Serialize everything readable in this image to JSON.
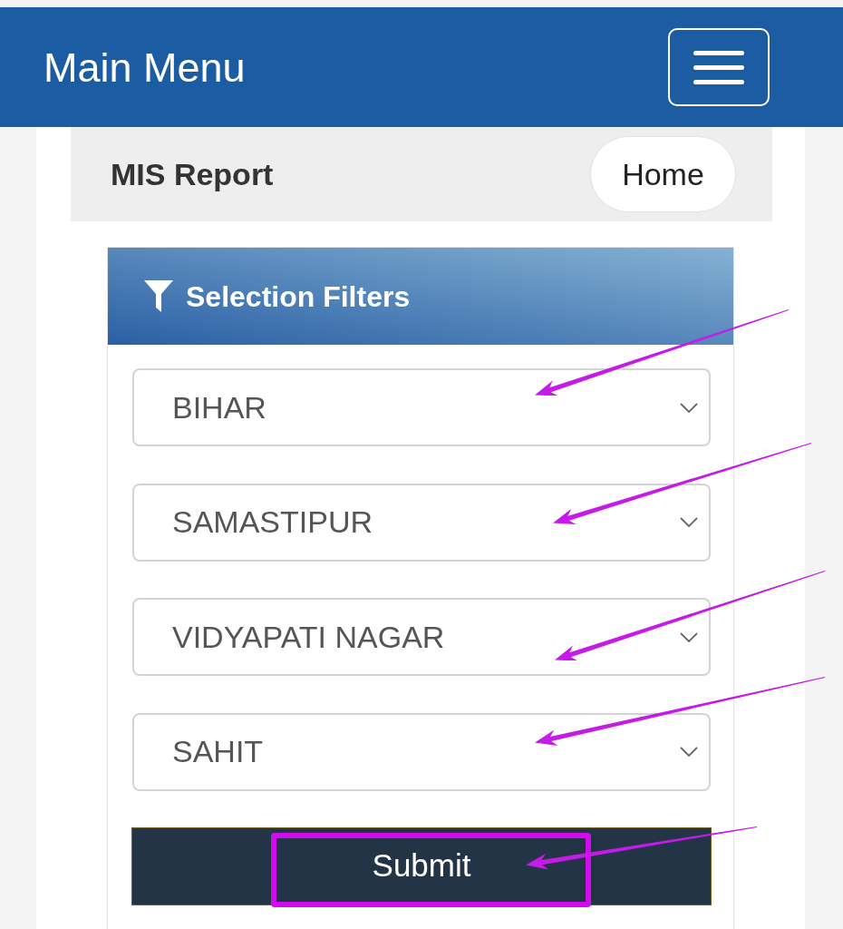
{
  "header": {
    "title": "Main Menu"
  },
  "breadcrumb_bar": {
    "title": "MIS Report",
    "home_button": "Home"
  },
  "filters_card": {
    "title": "Selection Filters",
    "dropdowns": [
      {
        "value": "BIHAR",
        "annotated": true
      },
      {
        "value": "SAMASTIPUR",
        "annotated": true
      },
      {
        "value": "VIDYAPATI NAGAR",
        "annotated": true
      },
      {
        "value": "SAHIT",
        "annotated": true
      }
    ],
    "submit_button": {
      "label": "Submit",
      "annotated": true,
      "highlighted": true
    }
  }
}
